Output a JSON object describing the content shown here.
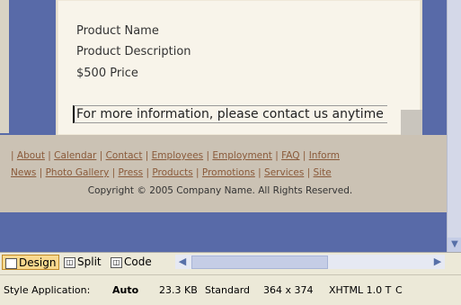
{
  "design_view": {
    "product": {
      "name": "Product Name",
      "description": "Product Description",
      "price": "$500 Price"
    },
    "info_text": "For more information, please contact us anytime",
    "footer": {
      "links_row1": [
        "About",
        "Calendar",
        "Contact",
        "Employees",
        "Employment",
        "FAQ",
        "Inform"
      ],
      "links_row2": [
        "News",
        "Photo Gallery",
        "Press",
        "Products",
        "Promotions",
        "Services",
        "Site"
      ],
      "copyright": "Copyright © 2005 Company Name. All Rights Reserved."
    }
  },
  "view_tabs": {
    "design": "Design",
    "split": "Split",
    "code": "Code"
  },
  "status": {
    "style_application_label": "Style Application:",
    "style_application_value": "Auto",
    "file_size": "23.3 KB",
    "connection_speed": "Standard",
    "page_dimensions": "364 x 374",
    "doctype": "XHTML 1.0 T",
    "extra": "C"
  },
  "colors": {
    "page_background": "#586aa8",
    "content_background": "#f8f4ea",
    "footer_band": "#cbc2b4",
    "link_color": "#8a5a3a",
    "active_tab": "#f9d98f"
  }
}
